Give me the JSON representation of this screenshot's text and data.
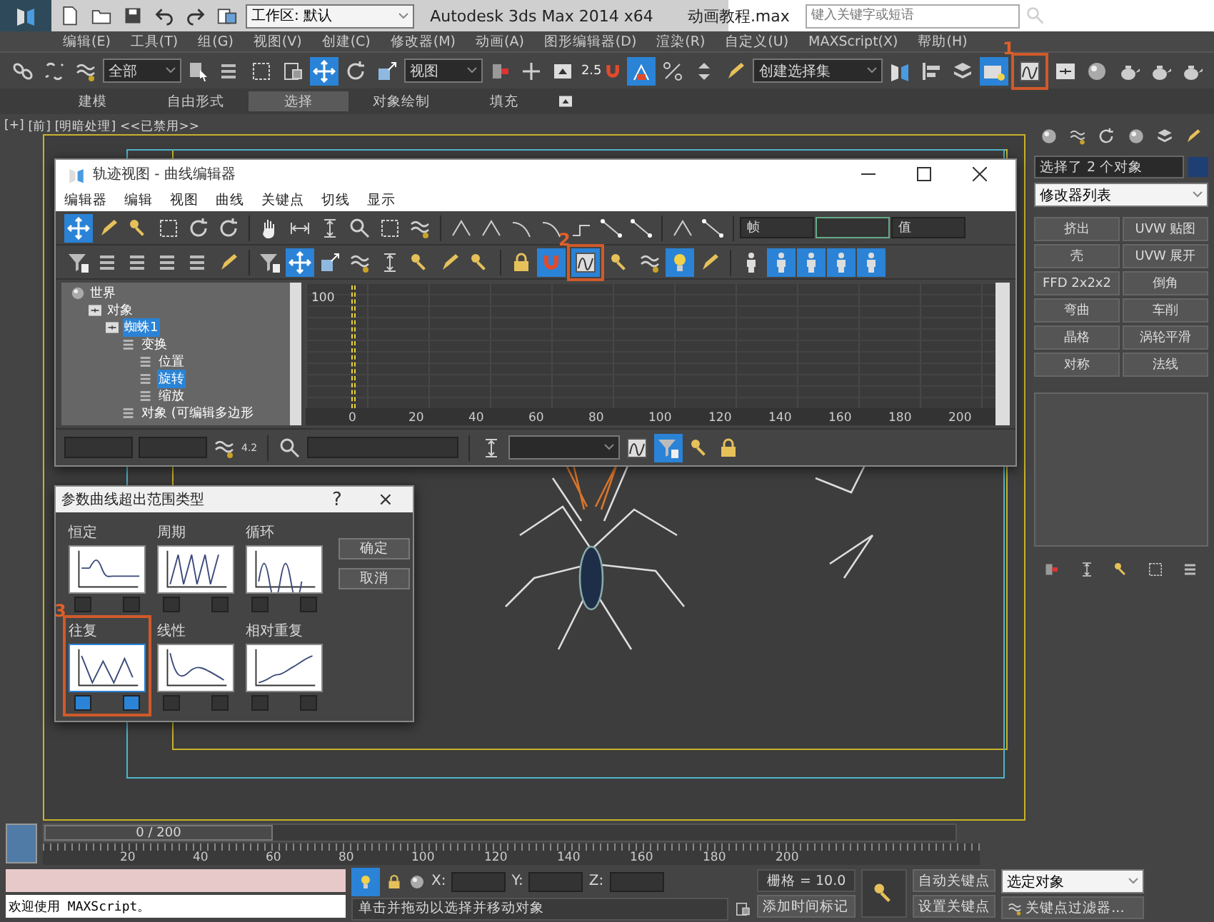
{
  "title_bar": {
    "workspace": "工作区: 默认",
    "title": "Autodesk 3ds Max  2014 x64",
    "file": "动画教程.max",
    "search": {
      "placeholder": "键入关键字或短语"
    }
  },
  "menu": [
    "编辑(E)",
    "工具(T)",
    "组(G)",
    "视图(V)",
    "创建(C)",
    "修改器(M)",
    "动画(A)",
    "图形编辑器(D)",
    "渲染(R)",
    "自定义(U)",
    "MAXScript(X)",
    "帮助(H)"
  ],
  "main_toolbar": [
    {
      "kind": "button",
      "selected": false
    },
    {
      "kind": "button",
      "selected": false
    },
    {
      "kind": "button",
      "selected": false
    },
    {
      "kind": "dropdown",
      "value": "全部"
    },
    {
      "kind": "button",
      "selected": false
    },
    {
      "kind": "button",
      "selected": false
    },
    {
      "kind": "button",
      "selected": false
    },
    {
      "kind": "button",
      "selected": false
    },
    {
      "kind": "button",
      "selected": true
    },
    {
      "kind": "button",
      "selected": false
    },
    {
      "kind": "button",
      "selected": false
    },
    {
      "kind": "dropdown",
      "value": "视图"
    },
    {
      "kind": "button",
      "selected": false
    },
    {
      "kind": "button",
      "selected": false
    },
    {
      "kind": "button",
      "selected": false
    },
    {
      "kind": "button",
      "label": "2.5",
      "selected": false
    },
    {
      "kind": "button",
      "selected": true
    },
    {
      "kind": "button",
      "selected": false
    },
    {
      "kind": "button",
      "selected": false
    },
    {
      "kind": "button",
      "selected": false
    },
    {
      "kind": "dropdown",
      "value": "创建选择集"
    },
    {
      "kind": "button",
      "selected": false
    },
    {
      "kind": "button",
      "selected": false
    },
    {
      "kind": "button",
      "selected": false
    },
    {
      "kind": "button",
      "selected": true
    },
    {
      "kind": "button",
      "selected": false,
      "callout": "1"
    },
    {
      "kind": "button",
      "selected": false
    },
    {
      "kind": "button",
      "selected": false
    },
    {
      "kind": "button",
      "selected": false
    },
    {
      "kind": "button",
      "selected": false
    },
    {
      "kind": "button",
      "selected": false
    }
  ],
  "ribbon": {
    "tabs": [
      {
        "label": "建模",
        "selected": false
      },
      {
        "label": "自由形式",
        "selected": false
      },
      {
        "label": "选择",
        "selected": true
      },
      {
        "label": "对象绘制",
        "selected": false
      },
      {
        "label": "填充",
        "selected": false
      }
    ]
  },
  "viewport": {
    "labels": [
      "[+]",
      "[前]",
      "[明暗处理]",
      "<<已禁用>>"
    ]
  },
  "curve_editor": {
    "title": "轨迹视图 - 曲线编辑器",
    "menu": [
      "编辑器",
      "编辑",
      "视图",
      "曲线",
      "关键点",
      "切线",
      "显示"
    ],
    "toolbar_1": [
      {
        "selected": true
      },
      {
        "selected": false
      },
      {
        "selected": false
      },
      {
        "selected": false
      },
      {
        "selected": false
      },
      {
        "selected": false
      },
      {
        "selected": false
      },
      {
        "selected": false
      },
      {
        "selected": false
      },
      {
        "selected": false
      },
      {
        "selected": false
      },
      {
        "selected": false
      },
      {
        "selected": false
      },
      {
        "selected": false
      },
      {
        "selected": false
      },
      {
        "selected": false
      },
      {
        "selected": false
      },
      {
        "selected": false
      },
      {
        "selected": false
      },
      {
        "selected": false
      },
      {
        "selected": false
      }
    ],
    "frame_label": "帧",
    "value_label": "值",
    "toolbar_2": [
      {
        "selected": false
      },
      {
        "selected": false
      },
      {
        "selected": false
      },
      {
        "selected": false
      },
      {
        "selected": false
      },
      {
        "selected": false
      },
      {
        "selected": false
      },
      {
        "selected": true
      },
      {
        "selected": false
      },
      {
        "selected": false
      },
      {
        "selected": false
      },
      {
        "selected": false
      },
      {
        "selected": false
      },
      {
        "selected": false
      },
      {
        "selected": false
      },
      {
        "selected": true
      },
      {
        "selected": true,
        "callout": "2"
      },
      {
        "selected": false
      },
      {
        "selected": false
      },
      {
        "selected": true
      },
      {
        "selected": false
      },
      {
        "selected": false
      },
      {
        "selected": true
      },
      {
        "selected": true
      },
      {
        "selected": true
      },
      {
        "selected": true
      }
    ],
    "tree": [
      {
        "label": "世界",
        "selected": false,
        "children": [
          {
            "label": "对象",
            "selected": false,
            "children": [
              {
                "label": "蜘蛛1",
                "selected": true,
                "children": [
                  {
                    "label": "变换",
                    "selected": false,
                    "children": [
                      {
                        "label": "位置",
                        "selected": false
                      },
                      {
                        "label": "旋转",
                        "selected": true
                      },
                      {
                        "label": "缩放",
                        "selected": false
                      }
                    ]
                  },
                  {
                    "label": "对象 (可编辑多边形",
                    "selected": false
                  }
                ]
              }
            ]
          }
        ]
      }
    ],
    "graph": {
      "value_tick": "100",
      "frame_ticks": [
        "0",
        "20",
        "40",
        "60",
        "80",
        "100",
        "120",
        "140",
        "160",
        "180",
        "200"
      ]
    },
    "curve_readout": "4.2"
  },
  "out_of_range_dialog": {
    "title": "参数曲线超出范围类型",
    "help": "?",
    "close": "×",
    "options": [
      {
        "kind": "constant",
        "label": "恒定",
        "selected": false
      },
      {
        "kind": "cycle",
        "label": "周期",
        "selected": false
      },
      {
        "kind": "loop",
        "label": "循环",
        "selected": false
      },
      {
        "kind": "ping_pong",
        "label": "往复",
        "selected": true,
        "callout": "3"
      },
      {
        "kind": "linear",
        "label": "线性",
        "selected": false
      },
      {
        "kind": "relative_repeat",
        "label": "相对重复",
        "selected": false
      }
    ],
    "buttons": [
      "确定",
      "取消"
    ]
  },
  "command_panel": {
    "selection": "选择了 2 个对象",
    "modifier_list": "修改器列表",
    "modifiers": [
      "挤出",
      "UVW 贴图",
      "壳",
      "UVW 展开",
      "FFD 2x2x2",
      "倒角",
      "弯曲",
      "车削",
      "晶格",
      "涡轮平滑",
      "对称",
      "法线"
    ]
  },
  "timeline": {
    "position": "0 / 200",
    "level": 0,
    "ticks": [
      "20",
      "40",
      "60",
      "80",
      "100",
      "120",
      "140",
      "160",
      "180",
      "200"
    ]
  },
  "status_bar": {
    "script_output": "欢迎使用 MAXScript。",
    "prompt": "单击并拖动以选择并移动对象",
    "coords": [
      "X:",
      "Y:",
      "Z:"
    ],
    "grid": "栅格 = 10.0",
    "add_time_tag": "添加时间标记",
    "auto_key": "自动关键点",
    "set_key": "设置关键点",
    "key_mode": "选定对象",
    "key_filters": "关键点过滤器..."
  }
}
